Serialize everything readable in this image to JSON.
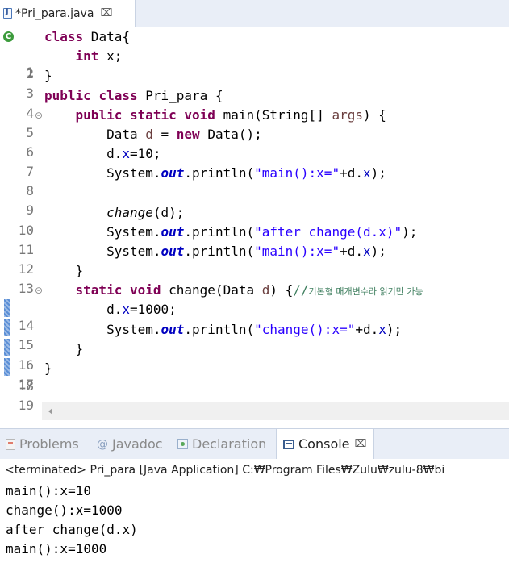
{
  "editor": {
    "tab": {
      "title": "*Pri_para.java",
      "close": "⌧"
    }
  },
  "code": {
    "line_numbers": [
      "1",
      "2",
      "3",
      "4",
      "5",
      "6",
      "7",
      "8",
      "9",
      "10",
      "11",
      "12",
      "13",
      "14",
      "15",
      "16",
      "17",
      "18",
      "19"
    ],
    "fold_markers": {
      "l5": "⊝",
      "l14": "⊝"
    },
    "run_marker": "C",
    "l1": {
      "kw": "class",
      "rest": " Data{"
    },
    "l2": {
      "indent": "    ",
      "kw": "int",
      "rest": " x;"
    },
    "l3": {
      "text": "}"
    },
    "l4": {
      "kw1": "public",
      "kw2": "class",
      "rest": " Pri_para {"
    },
    "l5": {
      "indent": "    ",
      "kw1": "public",
      "kw2": "static",
      "kw3": "void",
      "mid": " main(String[] ",
      "arg": "args",
      "end": ") {"
    },
    "l6": {
      "indent": "        ",
      "a": "Data ",
      "var": "d",
      "b": " = ",
      "kw": "new",
      "c": " Data();"
    },
    "l7": {
      "indent": "        ",
      "a": "d.",
      "fld": "x",
      "b": "=10;"
    },
    "l8": {
      "indent": "        ",
      "a": "System.",
      "sfld": "out",
      "b": ".println(",
      "str": "\"main():x=\"",
      "c": "+d.",
      "fld": "x",
      "d": ");"
    },
    "l10": {
      "indent": "        ",
      "itc": "change",
      "a": "(d);"
    },
    "l11": {
      "indent": "        ",
      "a": "System.",
      "sfld": "out",
      "b": ".println(",
      "str": "\"after change(d.x)\"",
      "c": ");"
    },
    "l12": {
      "indent": "        ",
      "a": "System.",
      "sfld": "out",
      "b": ".println(",
      "str": "\"main():x=\"",
      "c": "+d.",
      "fld": "x",
      "d": ");"
    },
    "l13": {
      "text": "    }"
    },
    "l14": {
      "indent": "    ",
      "kw1": "static",
      "kw2": "void",
      "a": " change(Data ",
      "var": "d",
      "b": ") {",
      "cmt": "//",
      "cmt_ko": "기본형 매개변수라 읽기만 가능"
    },
    "l15": {
      "indent": "        ",
      "a": "d.",
      "fld": "x",
      "b": "=1000;"
    },
    "l16": {
      "indent": "        ",
      "a": "System.",
      "sfld": "out",
      "b": ".println(",
      "str": "\"change():x=\"",
      "c": "+d.",
      "fld": "x",
      "d": ");"
    },
    "l17": {
      "text": "    }"
    },
    "l18": {
      "text": "}"
    }
  },
  "views": {
    "tabs": [
      {
        "label": "Problems",
        "icon": "problems-icon"
      },
      {
        "label": "Javadoc",
        "icon": "javadoc-icon",
        "glyph": "@"
      },
      {
        "label": "Declaration",
        "icon": "declaration-icon"
      },
      {
        "label": "Console",
        "icon": "console-icon",
        "close": "⌧"
      }
    ]
  },
  "console": {
    "status": "<terminated> Pri_para [Java Application] C:₩Program Files₩Zulu₩zulu-8₩bi",
    "output": [
      "main():x=10",
      "change():x=1000",
      "after change(d.x)",
      "main():x=1000"
    ]
  },
  "colors": {
    "keyword": "#7f0055",
    "string": "#2a00ff",
    "field": "#0000c0",
    "comment": "#3f7f5f",
    "local_var": "#6a3e3e",
    "tab_bar": "#e9eef7"
  }
}
